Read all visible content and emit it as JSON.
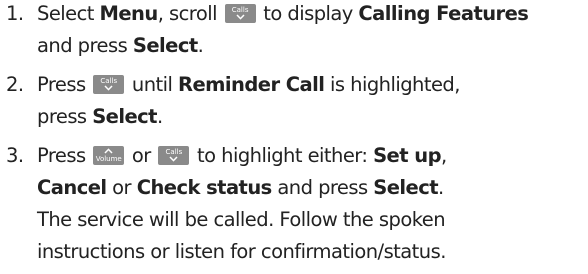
{
  "keys": {
    "calls_label": "Calls",
    "volume_label": "Volume"
  },
  "steps": [
    {
      "number": "1.",
      "line1": {
        "t1": "Select ",
        "b1": "Menu",
        "t2": ", scroll ",
        "t3": " to display ",
        "b2": "Calling Features"
      },
      "line2": {
        "t1": "and press ",
        "b1": "Select",
        "t2": "."
      }
    },
    {
      "number": "2.",
      "line1": {
        "t1": "Press ",
        "t2": " until ",
        "b1": "Reminder Call",
        "t3": " is highlighted,"
      },
      "line2": {
        "t1": "press ",
        "b1": "Select",
        "t2": "."
      }
    },
    {
      "number": "3.",
      "line1": {
        "t1": "Press ",
        "t2": " or ",
        "t3": " to highlight either: ",
        "b1": "Set up",
        "t4": ","
      },
      "line2": {
        "b1": "Cancel",
        "t1": " or ",
        "b2": "Check status",
        "t2": " and press ",
        "b3": "Select",
        "t3": "."
      },
      "line3": "The service will be called. Follow the spoken",
      "line4": "instructions or listen for confirmation/status."
    }
  ]
}
